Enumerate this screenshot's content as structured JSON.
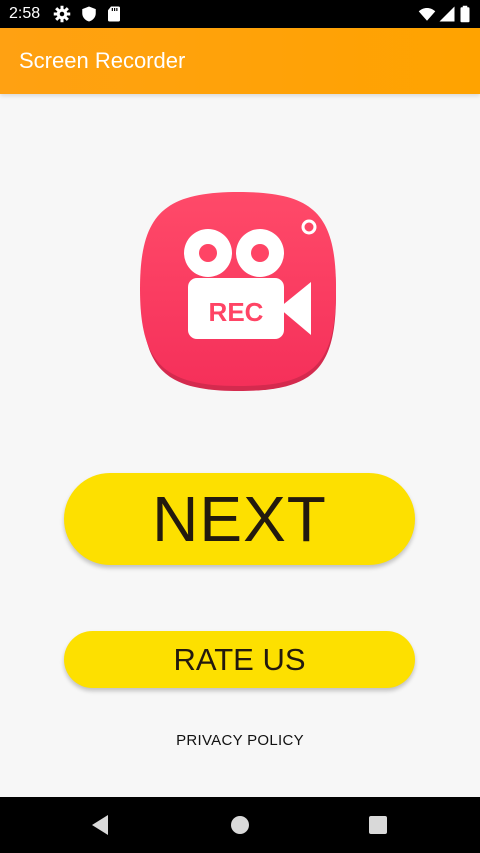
{
  "status_bar": {
    "time": "2:58",
    "icons": [
      "gear-icon",
      "shield-icon",
      "sd-card-icon",
      "wifi-icon",
      "signal-icon",
      "battery-icon"
    ]
  },
  "app_bar": {
    "title": "Screen Recorder",
    "color": "#ffa300"
  },
  "logo": {
    "label": "REC",
    "icon": "video-camera-icon",
    "color": "#ff3f5f"
  },
  "buttons": {
    "next_label": "NEXT",
    "rate_label": "RATE US",
    "color": "#fde000"
  },
  "links": {
    "privacy_label": "PRIVACY POLICY"
  },
  "nav_bar": {
    "icons": [
      "back-icon",
      "home-icon",
      "recents-icon"
    ]
  }
}
